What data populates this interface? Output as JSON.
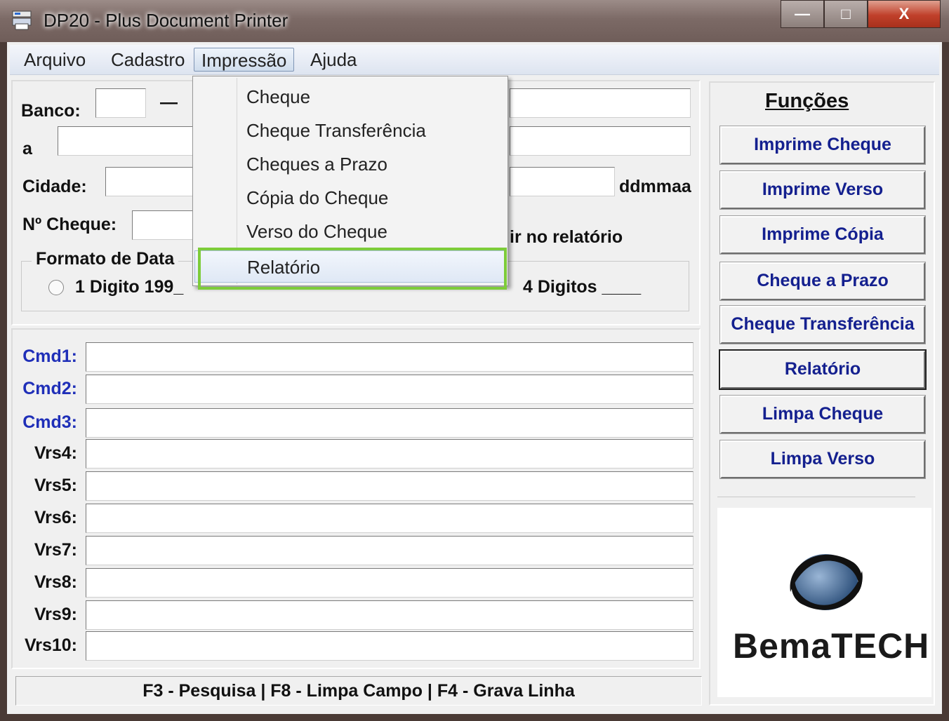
{
  "window": {
    "title": "DP20 - Plus Document Printer",
    "buttons": {
      "minimize": "—",
      "maximize": "□",
      "close": "X"
    }
  },
  "menubar": {
    "items": [
      "Arquivo",
      "Cadastro",
      "Impressão",
      "Ajuda"
    ],
    "active": "Impressão"
  },
  "dropdown": {
    "items": [
      "Cheque",
      "Cheque Transferência",
      "Cheques a Prazo",
      "Cópia do Cheque",
      "Verso do Cheque",
      "Relatório"
    ],
    "highlighted": "Relatório"
  },
  "form": {
    "banco_label": "Banco:",
    "banco_dash": "—",
    "a_label": "a",
    "cidade_label": "Cidade:",
    "ddmmaa": "ddmmaa",
    "cheque_label": "Nº Cheque:",
    "relatorio_text": "ir no relatório",
    "formato_title": "Formato de Data",
    "opt1": "1 Digito 199_",
    "opt3": "4 Digitos ____"
  },
  "commands": [
    {
      "label": "Cmd1:",
      "color": "#1f2fb8"
    },
    {
      "label": "Cmd2:",
      "color": "#1f2fb8"
    },
    {
      "label": "Cmd3:",
      "color": "#1f2fb8"
    },
    {
      "label": "Vrs4:",
      "color": "#111111"
    },
    {
      "label": "Vrs5:",
      "color": "#111111"
    },
    {
      "label": "Vrs6:",
      "color": "#111111"
    },
    {
      "label": "Vrs7:",
      "color": "#111111"
    },
    {
      "label": "Vrs8:",
      "color": "#111111"
    },
    {
      "label": "Vrs9:",
      "color": "#111111"
    },
    {
      "label": "Vrs10:",
      "color": "#111111"
    }
  ],
  "functions": {
    "title": "Funções",
    "buttons": [
      "Imprime Cheque",
      "Imprime Verso",
      "Imprime Cópia",
      "Cheque a Prazo",
      "Cheque Transferência",
      "Relatório",
      "Limpa Cheque",
      "Limpa Verso"
    ],
    "focused": "Relatório"
  },
  "logo": {
    "text": "BemaTECH",
    "ring_color": "#1a1a1a",
    "sphere_color": "#3a5f8a"
  },
  "statusbar": "F3 - Pesquisa  |  F8 - Limpa Campo  |  F4 - Grava Linha",
  "accent": {
    "highlight_green": "#7dcc3a",
    "link_blue": "#14208f"
  }
}
